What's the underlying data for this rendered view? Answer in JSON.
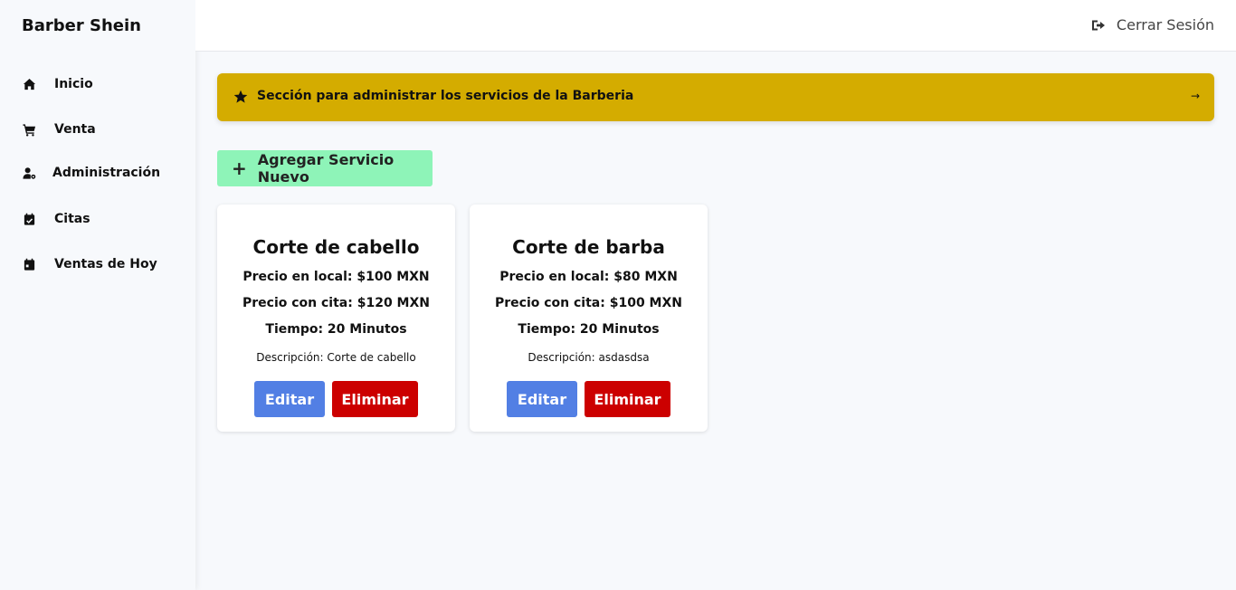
{
  "brand": "Barber Shein",
  "sidebar": {
    "items": [
      {
        "label": "Inicio",
        "icon": "home-icon"
      },
      {
        "label": "Venta",
        "icon": "cart-icon"
      },
      {
        "label": "Administración",
        "icon": "user-gear-icon"
      },
      {
        "label": "Citas",
        "icon": "calendar-check-icon"
      },
      {
        "label": "Ventas de Hoy",
        "icon": "calendar-day-icon"
      }
    ]
  },
  "topbar": {
    "logout_label": "Cerrar Sesión",
    "logout_icon": "sign-out-icon"
  },
  "banner": {
    "text": "Sección para administrar los servicios de la Barberia",
    "arrow": "→",
    "icon": "star-icon",
    "color": "#d4ac00"
  },
  "add_button": {
    "label": "Agregar Servicio Nuevo",
    "icon": "plus-icon",
    "color": "#8ef4b8"
  },
  "services": [
    {
      "title": "Corte de cabello",
      "precio_local": "Precio en local: $100 MXN",
      "precio_cita": "Precio con cita: $120 MXN",
      "tiempo": "Tiempo: 20 Minutos",
      "descripcion": "Descripción: Corte de cabello",
      "edit_label": "Editar",
      "delete_label": "Eliminar"
    },
    {
      "title": "Corte de barba",
      "precio_local": "Precio en local: $80 MXN",
      "precio_cita": "Precio con cita: $100 MXN",
      "tiempo": "Tiempo: 20 Minutos",
      "descripcion": "Descripción: asdasdsa",
      "edit_label": "Editar",
      "delete_label": "Eliminar"
    }
  ],
  "colors": {
    "edit": "#527fe4",
    "delete": "#cc0000"
  }
}
